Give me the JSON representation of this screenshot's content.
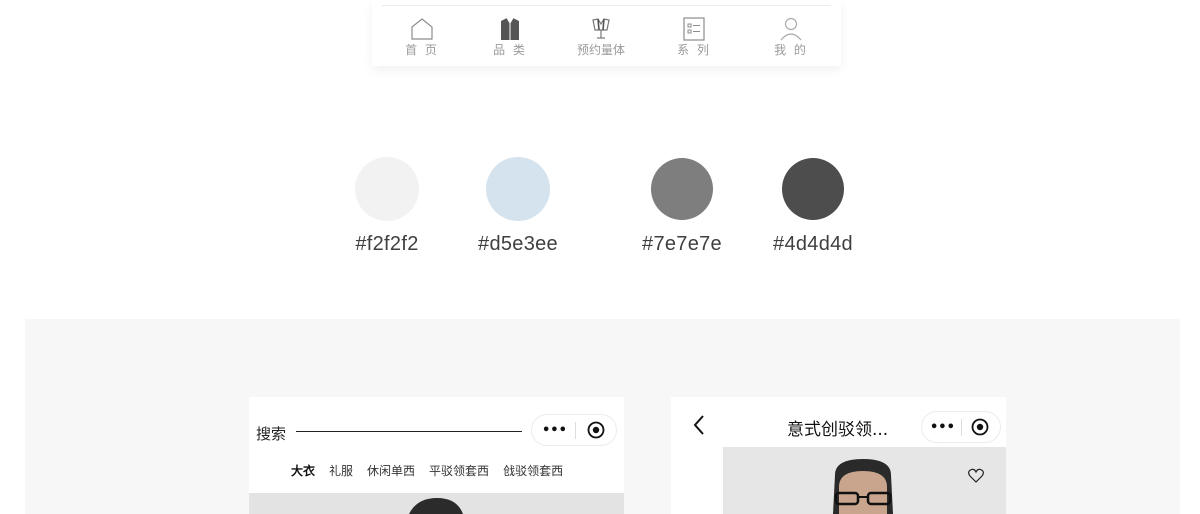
{
  "tabbar": {
    "items": [
      {
        "label": "首 页",
        "icon": "home-icon"
      },
      {
        "label": "品 类",
        "icon": "shirt-icon"
      },
      {
        "label": "预约量体",
        "icon": "measure-icon"
      },
      {
        "label": "系 列",
        "icon": "list-icon"
      },
      {
        "label": "我 的",
        "icon": "user-icon"
      }
    ]
  },
  "palette": [
    {
      "hex": "#f2f2f2",
      "color": "#f2f2f2"
    },
    {
      "hex": "#d5e3ee",
      "color": "#d5e3ee"
    },
    {
      "hex": "#7e7e7e",
      "color": "#7e7e7e"
    },
    {
      "hex": "#4d4d4d",
      "color": "#4d4d4d"
    }
  ],
  "screen_left": {
    "search_label": "搜索",
    "categories": [
      "大衣",
      "礼服",
      "休闲单西",
      "平驳领套西",
      "戗驳领套西"
    ],
    "active_category": "大衣",
    "capsule_more": "•••"
  },
  "screen_right": {
    "title": "意式创驳领...",
    "capsule_more": "•••"
  }
}
